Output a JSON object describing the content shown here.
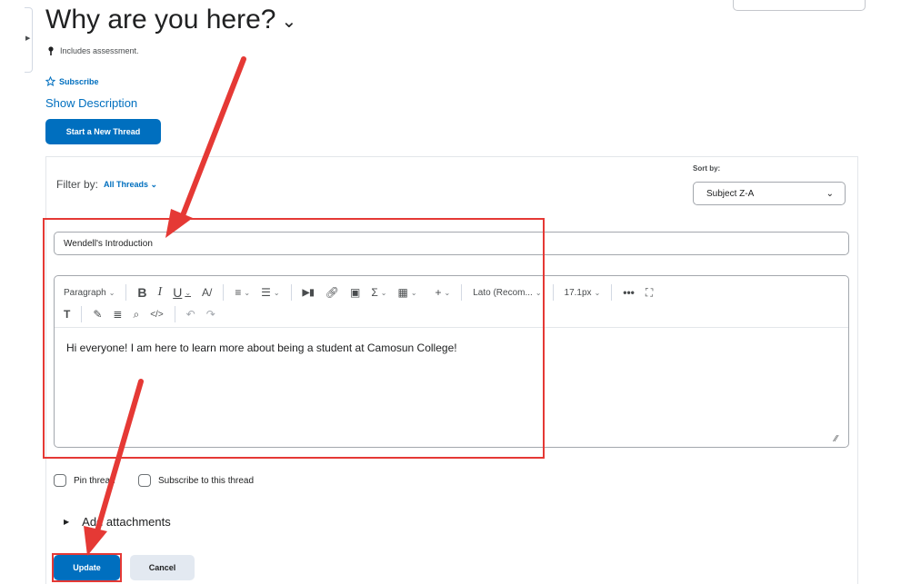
{
  "header": {
    "title": "Why are you here?",
    "assessment_note": "Includes assessment.",
    "subscribe_label": "Subscribe",
    "show_description_label": "Show Description",
    "new_thread_label": "Start a New Thread"
  },
  "filter": {
    "label": "Filter by:",
    "value": "All Threads",
    "sort_label": "Sort by:",
    "sort_value": "Subject Z-A"
  },
  "thread": {
    "subject_value": "Wendell's Introduction",
    "body_text": "Hi everyone!  I am here to learn more about being a student at Camosun College!"
  },
  "toolbar": {
    "paragraph_label": "Paragraph",
    "font_label": "Lato (Recom...",
    "size_label": "17.1px"
  },
  "options": {
    "pin_label": "Pin thread",
    "subscribe_thread_label": "Subscribe to this thread",
    "attachments_label": "Add attachments"
  },
  "actions": {
    "update_label": "Update",
    "cancel_label": "Cancel"
  },
  "colors": {
    "primary": "#006fbf",
    "annotation": "#e53935"
  }
}
